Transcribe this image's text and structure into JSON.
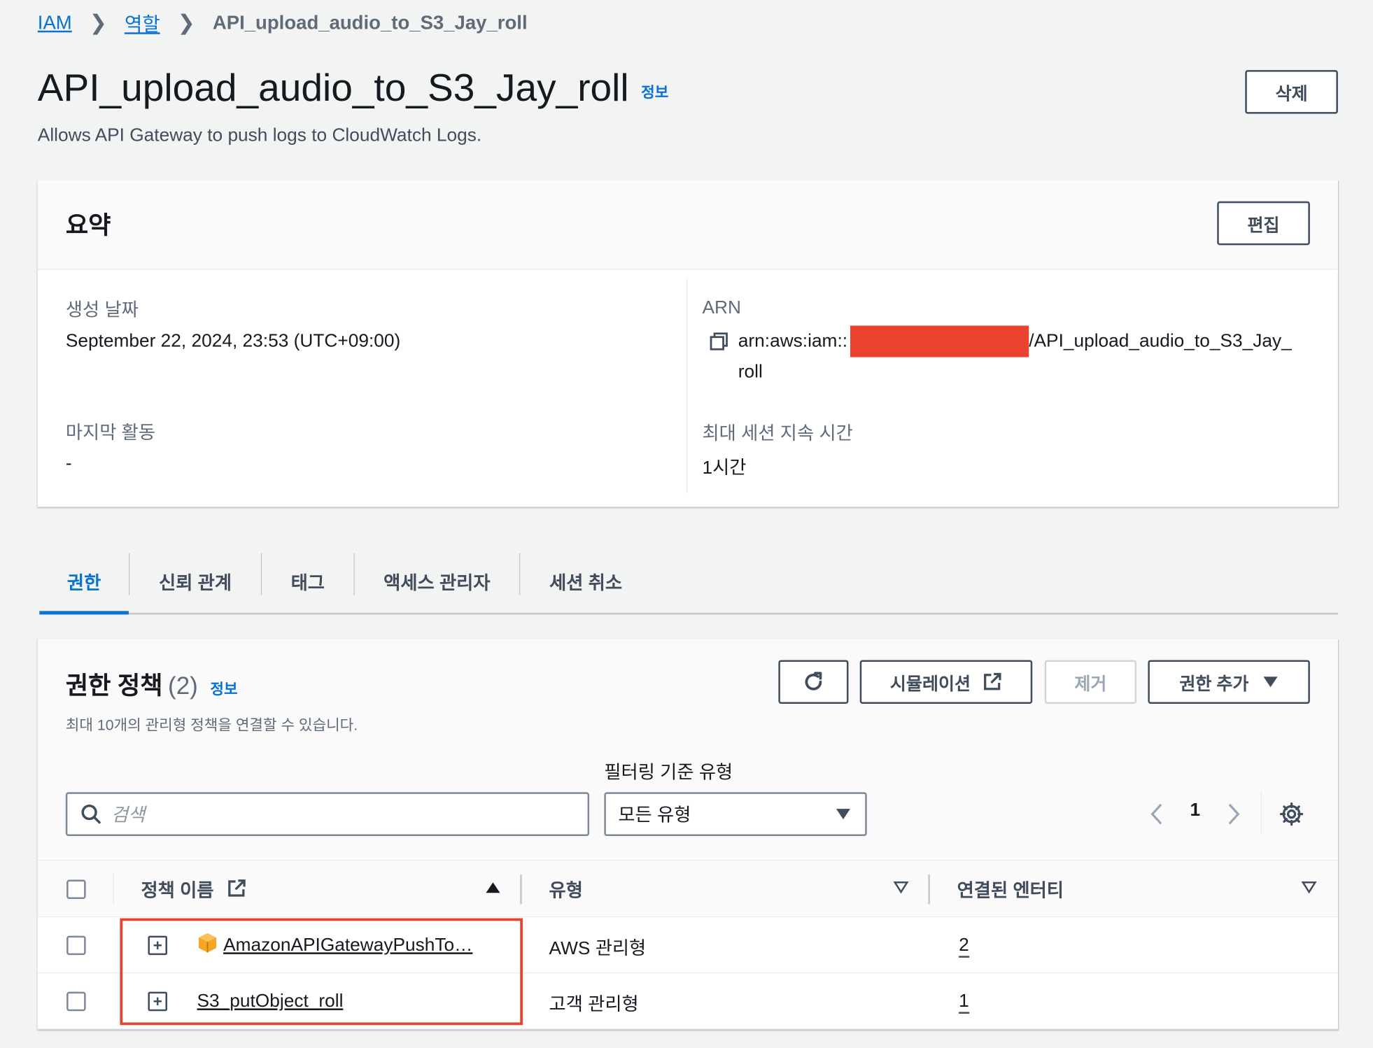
{
  "breadcrumb": {
    "items": [
      "IAM",
      "역할"
    ],
    "current": "API_upload_audio_to_S3_Jay_roll"
  },
  "header": {
    "title": "API_upload_audio_to_S3_Jay_roll",
    "info": "정보",
    "description": "Allows API Gateway to push logs to CloudWatch Logs.",
    "delete_label": "삭제"
  },
  "summary": {
    "title": "요약",
    "edit_label": "편집",
    "created_label": "생성 날짜",
    "created_value": "September 22, 2024, 23:53 (UTC+09:00)",
    "last_activity_label": "마지막 활동",
    "last_activity_value": "-",
    "arn_label": "ARN",
    "arn_prefix": "arn:aws:iam::",
    "arn_suffix": "/API_upload_audio_to_S3_Jay_",
    "arn_suffix2": "roll",
    "max_session_label": "최대 세션 지속 시간",
    "max_session_value": "1시간"
  },
  "tabs": [
    "권한",
    "신뢰 관계",
    "태그",
    "액세스 관리자",
    "세션 취소"
  ],
  "policies": {
    "title": "권한 정책",
    "count": "(2)",
    "info": "정보",
    "subtitle": "최대 10개의 관리형 정책을 연결할 수 있습니다.",
    "simulate_label": "시뮬레이션",
    "remove_label": "제거",
    "add_label": "권한 추가",
    "filter_label": "필터링 기준 유형",
    "search_placeholder": "검색",
    "select_value": "모든 유형",
    "page": "1",
    "columns": [
      "정책 이름",
      "유형",
      "연결된 엔터티"
    ],
    "rows": [
      {
        "name": "AmazonAPIGatewayPushTo…",
        "type": "AWS 관리형",
        "entities": "2"
      },
      {
        "name": "S3_putObject_roll",
        "type": "고객 관리형",
        "entities": "1"
      }
    ]
  },
  "colors": {
    "accent": "#0972d3",
    "redaction": "#e9422e"
  }
}
